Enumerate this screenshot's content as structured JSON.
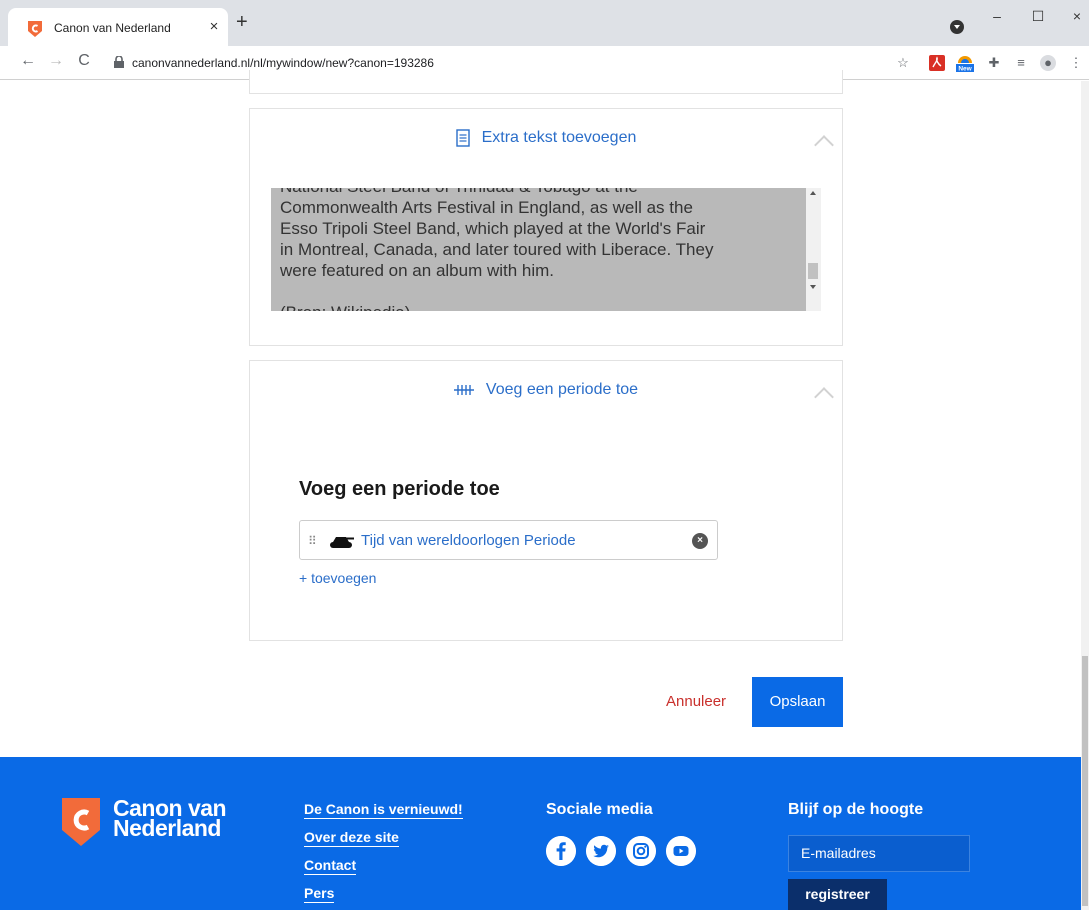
{
  "browser": {
    "tab_title": "Canon van Nederland",
    "tab_close": "×",
    "new_tab": "+",
    "url": "canonvannederland.nl/nl/mywindow/new?canon=193286",
    "window_minimize": "–",
    "window_maximize": "☐",
    "window_close": "×",
    "extension_new_badge": "New"
  },
  "extra_text_card": {
    "header": "Extra tekst toevoegen",
    "icon": "document-icon",
    "textarea_value": "National Steel Band of Trinidad & Tobago at the\nCommonwealth Arts Festival in England, as well as the\nEsso Tripoli Steel Band, which played at the World's Fair\nin Montreal, Canada, and later toured with Liberace. They\nwere featured on an album with him.\n\n(Bron: Wikipedia)"
  },
  "period_card": {
    "header": "Voeg een periode toe",
    "icon": "timeline-icon",
    "section_title": "Voeg een periode toe",
    "period_label": "Tijd van wereldoorlogen Periode",
    "clear_label": "×",
    "add_link": "+ toevoegen"
  },
  "actions": {
    "cancel": "Annuleer",
    "save": "Opslaan"
  },
  "footer": {
    "logo_line1": "Canon van",
    "logo_line2": "Nederland",
    "links": [
      "De Canon is vernieuwd!",
      "Over deze site",
      "Contact",
      "Pers"
    ],
    "social_heading": "Sociale media",
    "social_icons": [
      "facebook-icon",
      "twitter-icon",
      "instagram-icon",
      "youtube-icon"
    ],
    "newsletter_heading": "Blijf op de hoogte",
    "email_placeholder": "E-mailadres",
    "register": "registreer"
  },
  "colors": {
    "brand_blue": "#0a6ae6",
    "link_blue": "#2b6ec9",
    "cancel_red": "#c9302c",
    "logo_orange": "#f26b3a"
  }
}
